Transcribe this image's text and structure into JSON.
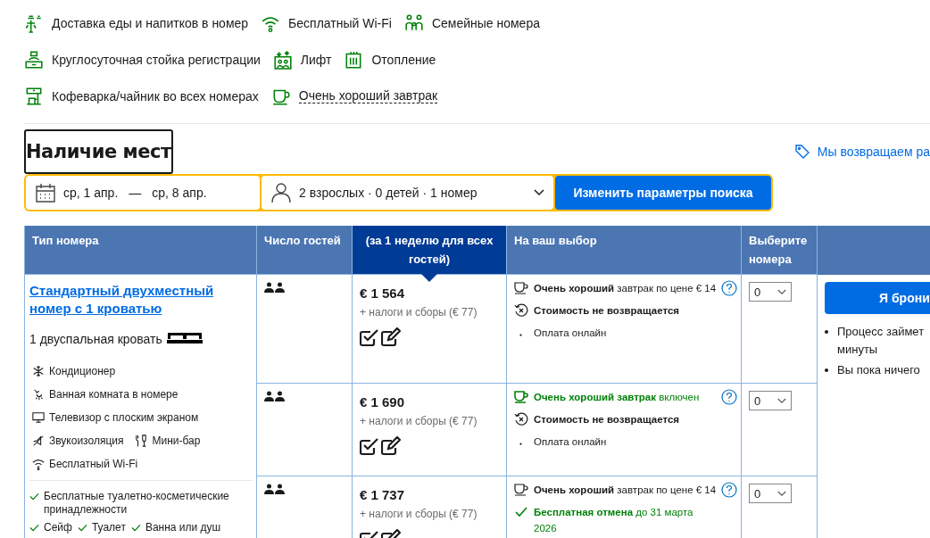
{
  "facilities": [
    [
      {
        "label": "Доставка еды и напитков в номер",
        "underlined": false
      },
      {
        "label": "Бесплатный Wi-Fi",
        "underlined": false
      },
      {
        "label": "Семейные номера",
        "underlined": false
      }
    ],
    [
      {
        "label": "Круглосуточная стойка регистрации",
        "underlined": false
      },
      {
        "label": "Лифт",
        "underlined": false
      },
      {
        "label": "Отопление",
        "underlined": false
      }
    ],
    [
      {
        "label": "Кофеварка/чайник во всех номерах",
        "underlined": false
      },
      {
        "label": "Очень хороший завтрак",
        "underlined": true
      }
    ]
  ],
  "availability": {
    "heading": "Наличие мест",
    "promo_link": "Мы возвращаем ра"
  },
  "search": {
    "date_start": "ср, 1 апр.",
    "date_separator": "—",
    "date_end": "ср, 8 апр.",
    "guests": "2 взрослых · 0 детей · 1 номер",
    "button": "Изменить параметры поиска"
  },
  "table": {
    "columns": [
      {
        "label": "Тип номера",
        "selected": false
      },
      {
        "label": "Число гостей",
        "selected": false
      },
      {
        "label": "(за 1 неделю для всех гостей)",
        "selected": true
      },
      {
        "label": "На ваш выбор",
        "selected": false
      },
      {
        "label": "Выберите номера",
        "selected": false
      }
    ],
    "room": {
      "title": "Стандартный двухместный номер с 1 кроватью",
      "bed": "1 двуспальная кровать",
      "amenities": [
        [
          "Кондиционер"
        ],
        [
          "Ванная комната в номере"
        ],
        [
          "Телевизор с плоским экраном"
        ],
        [
          "Звукоизоляция",
          "Мини-бар"
        ],
        [
          "Бесплатный Wi-Fi"
        ]
      ],
      "extras": [
        [
          "Бесплатные туалетно-косметические принадлежности"
        ],
        [
          "Сейф",
          "Туалет",
          "Ванна или душ"
        ]
      ]
    },
    "offers": [
      {
        "price": "€ 1 564",
        "taxes": "+ налоги и сборы (€ 77)",
        "quantity": "0",
        "conditions": [
          {
            "kind": "meal",
            "included": false,
            "text": "**Очень хороший** завтрак по цене € 14"
          },
          {
            "kind": "nonrefundable",
            "text": "Стоимость не возвращается"
          },
          {
            "kind": "payment",
            "text": "Оплата онлайн"
          }
        ]
      },
      {
        "price": "€ 1 690",
        "taxes": "+ налоги и сборы (€ 77)",
        "quantity": "0",
        "conditions": [
          {
            "kind": "meal",
            "included": true,
            "text": "**Очень хороший завтрак** включен"
          },
          {
            "kind": "nonrefundable",
            "text": "Стоимость не возвращается"
          },
          {
            "kind": "payment",
            "text": "Оплата онлайн"
          }
        ]
      },
      {
        "price": "€ 1 737",
        "taxes": "+ налоги и сборы (€ 77)",
        "quantity": "0",
        "conditions": [
          {
            "kind": "meal",
            "included": false,
            "text": "**Очень хороший** завтрак по цене € 14"
          },
          {
            "kind": "free_cancellation",
            "text": "**Бесплатная отмена** до 31 марта 2026"
          }
        ]
      }
    ],
    "booking": {
      "button": "Я брони",
      "notes": [
        [
          "Процесс займет",
          "минуты"
        ],
        [
          "Вы пока ничего"
        ]
      ]
    }
  }
}
